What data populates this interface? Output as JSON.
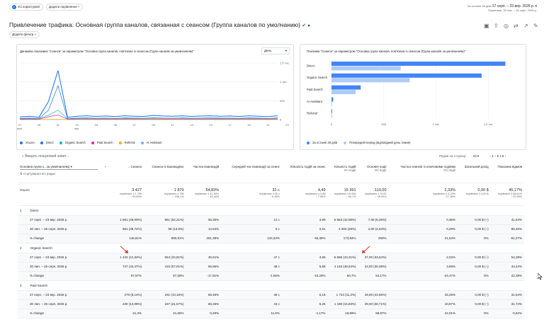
{
  "header": {
    "segment_chip": "Усі користувачі",
    "compare_chip": "Додати порівняння",
    "date_range_label": "За останні 28 днів",
    "date_range": "27 серп. – 23 вер. 2026 р.",
    "compare_range": "Порівняно: 30 лип. – 26 серп. 2026 р."
  },
  "page": {
    "title": "Привлечение трафика: Основная группа каналов, связанная с сеансом (Группа каналов по умолчанию)",
    "add_filter": "Додати фільтр"
  },
  "line_chart": {
    "title": "Динаміка показника \"Сеанси\" за параметром \"Основна група каналів, пов'язана із сеансом (Група каналів за умовчанням)\"",
    "granularity": "День",
    "y_ticks": [
      "1,5 тис.",
      "1 тис.",
      "500",
      "0"
    ],
    "x_ticks": [
      {
        "d": "27",
        "m": "серп."
      },
      {
        "d": "29",
        "m": ""
      },
      {
        "d": "31",
        "m": ""
      },
      {
        "d": "01",
        "m": "вер."
      },
      {
        "d": "03",
        "m": ""
      },
      {
        "d": "05",
        "m": ""
      },
      {
        "d": "07",
        "m": ""
      },
      {
        "d": "09",
        "m": ""
      },
      {
        "d": "11",
        "m": ""
      },
      {
        "d": "13",
        "m": ""
      },
      {
        "d": "15",
        "m": ""
      },
      {
        "d": "17",
        "m": ""
      },
      {
        "d": "19",
        "m": ""
      },
      {
        "d": "21",
        "m": ""
      },
      {
        "d": "23",
        "m": ""
      }
    ],
    "legend": [
      {
        "label": "Усього",
        "color": "#1a73e8"
      },
      {
        "label": "Direct",
        "color": "#1a73e8"
      },
      {
        "label": "Organic Search",
        "color": "#12b5cb"
      },
      {
        "label": "Paid Search",
        "color": "#e52592"
      },
      {
        "label": "Referral",
        "color": "#f9ab00"
      },
      {
        "label": "AI Assistant",
        "color": "#7baaf7"
      }
    ]
  },
  "chart_data": [
    {
      "type": "line",
      "title": "Динаміка показника \"Сеанси\" за параметром \"Основна група каналів, пов'язана із сеансом (Група каналів за умовчанням)\"",
      "x": [
        "27",
        "28",
        "29",
        "30",
        "31",
        "01",
        "02",
        "03",
        "04",
        "05",
        "06",
        "07",
        "08",
        "09",
        "10",
        "11",
        "12",
        "13",
        "14",
        "15",
        "16",
        "17",
        "18",
        "19",
        "20",
        "21",
        "22",
        "23"
      ],
      "ylim": [
        0,
        1500
      ],
      "series": [
        {
          "name": "Усього",
          "color": "#1a73e8",
          "values": [
            70,
            90,
            60,
            480,
            1300,
            60,
            90,
            100,
            85,
            95,
            80,
            100,
            90,
            85,
            110,
            95,
            90,
            100,
            85,
            95,
            100,
            90,
            95,
            85,
            100,
            90,
            80,
            100
          ]
        },
        {
          "name": "Direct",
          "color": "#1a73e8",
          "values": [
            30,
            40,
            25,
            250,
            900,
            25,
            40,
            45,
            35,
            40,
            30,
            45,
            40,
            35,
            50,
            40,
            35,
            45,
            35,
            40,
            45,
            40,
            40,
            35,
            45,
            40,
            30,
            45
          ]
        },
        {
          "name": "Organic Search",
          "color": "#12b5cb",
          "values": [
            25,
            30,
            20,
            120,
            250,
            20,
            30,
            35,
            30,
            35,
            30,
            35,
            30,
            30,
            40,
            35,
            35,
            35,
            30,
            35,
            35,
            30,
            35,
            30,
            35,
            30,
            30,
            35
          ]
        },
        {
          "name": "Paid Search",
          "color": "#e52592",
          "values": [
            10,
            15,
            10,
            80,
            120,
            10,
            15,
            15,
            15,
            15,
            15,
            15,
            15,
            15,
            15,
            15,
            15,
            15,
            15,
            15,
            15,
            15,
            15,
            15,
            15,
            15,
            15,
            15
          ]
        },
        {
          "name": "Referral",
          "color": "#f9ab00",
          "values": [
            3,
            4,
            3,
            5,
            8,
            3,
            4,
            4,
            3,
            4,
            4,
            4,
            3,
            4,
            4,
            3,
            4,
            4,
            3,
            4,
            4,
            3,
            4,
            4,
            3,
            4,
            3,
            4
          ]
        },
        {
          "name": "AI Assistant",
          "color": "#7baaf7",
          "values": [
            1,
            2,
            1,
            2,
            3,
            1,
            2,
            2,
            1,
            2,
            1,
            2,
            2,
            1,
            2,
            1,
            2,
            2,
            1,
            2,
            1,
            2,
            2,
            1,
            2,
            1,
            2,
            2
          ]
        }
      ]
    },
    {
      "type": "bar",
      "title": "Показник \"Сеанси\" за параметром \"Основна група каналів, пов'язана із сеансом (Група каналів за умовчанням)\"",
      "categories": [
        "Direct",
        "Organic Search",
        "Paid Search",
        "AI Assistant",
        "Referral"
      ],
      "xlim": [
        0,
        1800
      ],
      "x_ticks": [
        "0",
        "500",
        "1 тис.",
        "1,5 тис."
      ],
      "series": [
        {
          "name": "За останні 28 днів",
          "color": "#4285f4",
          "values": [
            1661,
            1434,
            279,
            16,
            5
          ]
        },
        {
          "name": "Попередній період (відповідний день тижня)",
          "color": "#aecbfa",
          "values": [
            661,
            747,
            230,
            3,
            2
          ]
        }
      ]
    }
  ],
  "table": {
    "search_placeholder": "Введіть пошуковий запит...",
    "rows_per_page_label": "Рядків на сторінці:",
    "rows_per_page": "10",
    "pagination": "1 – 6 з 6",
    "dimension_select": "Основна група к...за умовчанням)",
    "subdimension_label": "Сеанси",
    "reset_order": "Сортування всі рядки",
    "columns": [
      "Сеанси",
      "Сеанси із взаємодією",
      "Частка взаємодій",
      "Середній час взаємодії за сеанс",
      "Кількість подій за сеанс",
      "Кількість подій",
      "Основні події",
      "Частка сеансів із ключовими подіями",
      "Загальний дохід",
      "Показник відмов"
    ],
    "sub_columns": [
      "",
      "",
      "",
      "",
      "",
      "Усі події",
      "Усі події",
      "Усі події",
      "",
      ""
    ],
    "total": {
      "label": "Усього",
      "values": [
        "3 427",
        "1 879",
        "54,83%",
        "32 с",
        "4,49",
        "15 391",
        "110,00",
        "2,33%",
        "0,00 $",
        "45,17%"
      ],
      "compare": [
        "порівняно з 1 759",
        "порівняно з 728",
        "порівняно з 41,39%",
        "порівняно з 30 с",
        "порівняно з 4,86",
        "порівняно з 8 546",
        "порівняно з 79,00",
        "порівняно з 3,24%",
        "порівняно з 0,00 $",
        "порівняно з 58,61%"
      ],
      "delta": [
        "↑ 94,83%",
        "↑ 158,1%",
        "↑ 32,48%",
        "↑ 6,38%",
        "↓ 7,56%",
        "↑ 80,1%",
        "↑ 39,24%",
        "↓ 27,96%",
        "",
        "↓ 22,93%"
      ]
    },
    "groups": [
      {
        "index": "1",
        "name": "Direct",
        "rows": [
          {
            "label": "27 серп. – 23 вер. 2026 р.",
            "values": [
              "1 661 (49,00%)",
              "961 (52,21%)",
              "58,36%",
              "14 с",
              "3,90",
              "6 553 (42,58%)",
              "7,00 (6,36%)",
              "0,36%",
              "0,00 $ (–)",
              "41,64%"
            ]
          },
          {
            "label": "30 лип. – 26 серп. 2026 р.",
            "values": [
              "661 (38,72%)",
              "99 (13,6%)",
              "14,54%",
              "6 с",
              "2,51",
              "2 393 (28%)",
              "2,00 (2,53%)",
              "0,29%",
              "0,00 $ (–)",
              "85,46%"
            ]
          },
          {
            "label": "% change",
            "values": [
              "146,81%",
              "890,91%",
              "301,38%",
              "133,33%",
              "55,38%",
              "173,84%",
              "250%",
              "21,53%",
              "0%",
              "-51,27%"
            ]
          }
        ]
      },
      {
        "index": "2",
        "name": "Organic Search",
        "rows": [
          {
            "label": "27 серп. – 23 вер. 2026 р.",
            "values": [
              "1 434 (41,84%)",
              "654 (34,81%)",
              "45,61%",
              "47 с",
              "4,65",
              "6 666 (43,31%)",
              "37,00 (33,64%)",
              "2,02%",
              "0,00 $ (–)",
              "54,39%"
            ]
          },
          {
            "label": "30 лип. – 26 серп. 2026 р.",
            "values": [
              "747 (42,47%)",
              "415 (57,01%)",
              "55,56%",
              "48 с",
              "5,55",
              "4 148 (48,54%)",
              "24,00 (30,38%)",
              "3,68%",
              "0,00 $ (–)",
              "44,44%"
            ]
          },
          {
            "label": "% change",
            "values": [
              "97,97%",
              "57,59%",
              "-17,91%",
              "-1,06%",
              "-16,29%",
              "60,7%",
              "54,17%",
              "-24,47%",
              "0%",
              "22,38%"
            ]
          }
        ]
      },
      {
        "index": "3",
        "name": "Paid Search",
        "rows": [
          {
            "label": "27 серп. – 23 вер. 2026 р.",
            "values": [
              "279 (8,14%)",
              "191 (10,16%)",
              "68,46%",
              "49 с",
              "6,18",
              "1 724 (11,2%)",
              "49,00 (44,55%)",
              "15,26%",
              "0,00 $ (–)",
              "31,54%"
            ]
          },
          {
            "label": "30 лип. – 26 серп. 2026 р.",
            "values": [
              "230 (13,08%)",
              "157 (21,57%)",
              "68,26%",
              "44 с",
              "6,25",
              "1 438 (16,83%)",
              "29,00 (36,71%)",
              "10,87%",
              "0,00 $ (–)",
              "31,74%"
            ]
          },
          {
            "label": "% change",
            "values": [
              "21,3%",
              "21,66%",
              "0,29%",
              "11,9%",
              "-1,17%",
              "19,89%",
              "68,97%",
              "22,01%",
              "0%",
              "-0,62%"
            ]
          }
        ]
      }
    ]
  }
}
